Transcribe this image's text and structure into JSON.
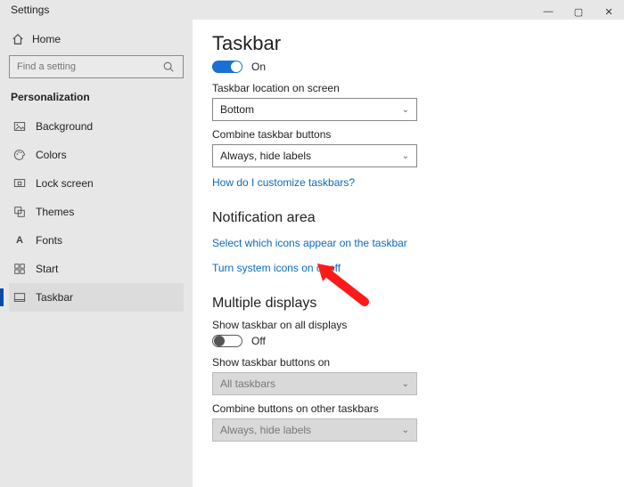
{
  "titlebar": {
    "title": "Settings"
  },
  "home": {
    "label": "Home"
  },
  "search": {
    "placeholder": "Find a setting"
  },
  "category": {
    "label": "Personalization"
  },
  "nav": {
    "items": [
      {
        "label": "Background"
      },
      {
        "label": "Colors"
      },
      {
        "label": "Lock screen"
      },
      {
        "label": "Themes"
      },
      {
        "label": "Fonts"
      },
      {
        "label": "Start"
      },
      {
        "label": "Taskbar"
      }
    ]
  },
  "page": {
    "title": "Taskbar",
    "toggle_main": {
      "state": "On"
    },
    "location": {
      "label": "Taskbar location on screen",
      "value": "Bottom"
    },
    "combine": {
      "label": "Combine taskbar buttons",
      "value": "Always, hide labels"
    },
    "customize_link": "How do I customize taskbars?",
    "notif_heading": "Notification area",
    "notif_link1": "Select which icons appear on the taskbar",
    "notif_link2": "Turn system icons on or off",
    "multi_heading": "Multiple displays",
    "multi_show_label": "Show taskbar on all displays",
    "multi_show_state": "Off",
    "multi_buttons": {
      "label": "Show taskbar buttons on",
      "value": "All taskbars"
    },
    "multi_combine": {
      "label": "Combine buttons on other taskbars",
      "value": "Always, hide labels"
    }
  }
}
